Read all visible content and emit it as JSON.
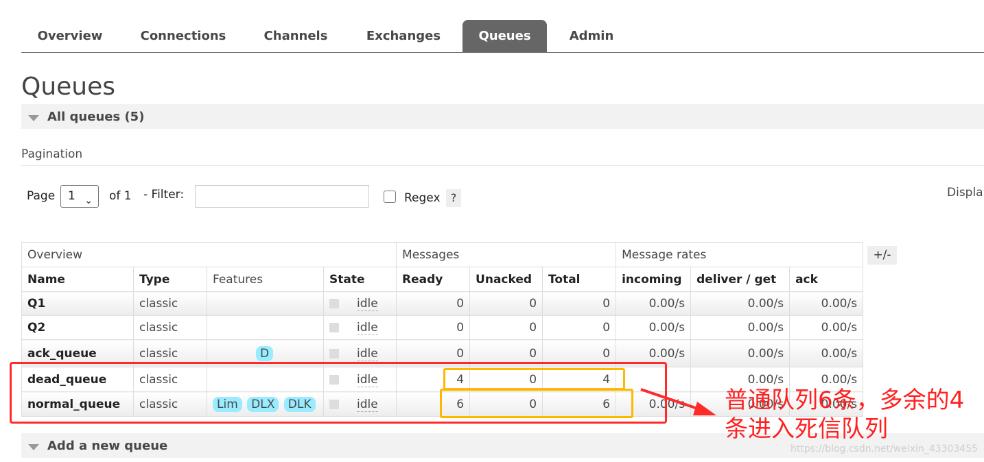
{
  "nav": {
    "tabs": [
      {
        "label": "Overview",
        "active": false
      },
      {
        "label": "Connections",
        "active": false
      },
      {
        "label": "Channels",
        "active": false
      },
      {
        "label": "Exchanges",
        "active": false
      },
      {
        "label": "Queues",
        "active": true
      },
      {
        "label": "Admin",
        "active": false
      }
    ]
  },
  "page": {
    "title": "Queues",
    "all_queues_header": "All queues (5)",
    "add_queue_header": "Add a new queue"
  },
  "pagination": {
    "label": "Pagination",
    "page_label": "Page",
    "page_value": "1",
    "of_label": "of 1",
    "filter_label": "- Filter:",
    "filter_value": "",
    "regex_label": "Regex",
    "help_label": "?",
    "display_label": "Displa"
  },
  "table": {
    "group_headers": {
      "overview": "Overview",
      "messages": "Messages",
      "message_rates": "Message rates"
    },
    "columns": {
      "name": "Name",
      "type": "Type",
      "features": "Features",
      "state": "State",
      "ready": "Ready",
      "unacked": "Unacked",
      "total": "Total",
      "incoming": "incoming",
      "deliver_get": "deliver / get",
      "ack": "ack"
    },
    "plus_minus": "+/-",
    "rows": [
      {
        "name": "Q1",
        "type": "classic",
        "features": [],
        "state": "idle",
        "ready": "0",
        "unacked": "0",
        "total": "0",
        "incoming": "0.00/s",
        "deliver_get": "0.00/s",
        "ack": "0.00/s"
      },
      {
        "name": "Q2",
        "type": "classic",
        "features": [],
        "state": "idle",
        "ready": "0",
        "unacked": "0",
        "total": "0",
        "incoming": "0.00/s",
        "deliver_get": "0.00/s",
        "ack": "0.00/s"
      },
      {
        "name": "ack_queue",
        "type": "classic",
        "features": [
          "D"
        ],
        "state": "idle",
        "ready": "0",
        "unacked": "0",
        "total": "0",
        "incoming": "0.00/s",
        "deliver_get": "0.00/s",
        "ack": "0.00/s"
      },
      {
        "name": "dead_queue",
        "type": "classic",
        "features": [],
        "state": "idle",
        "ready": "4",
        "unacked": "0",
        "total": "4",
        "incoming": "",
        "deliver_get": "0.00/s",
        "ack": "0.00/s"
      },
      {
        "name": "normal_queue",
        "type": "classic",
        "features": [
          "Lim",
          "DLX",
          "DLK"
        ],
        "state": "idle",
        "ready": "6",
        "unacked": "0",
        "total": "6",
        "incoming": "0.00/s",
        "deliver_get": "0.00/s",
        "ack": "0.00/s"
      }
    ]
  },
  "annotation": {
    "note": "普通队列6条，多余的4条进入死信队列",
    "box_color": "#ff2a2a",
    "highlight_color": "#ffb800"
  },
  "watermark": "https://blog.csdn.net/weixin_43303455",
  "colors": {
    "active_tab": "#666666",
    "feature_badge": "#99ebff",
    "section_bg": "#f2f2f2"
  }
}
